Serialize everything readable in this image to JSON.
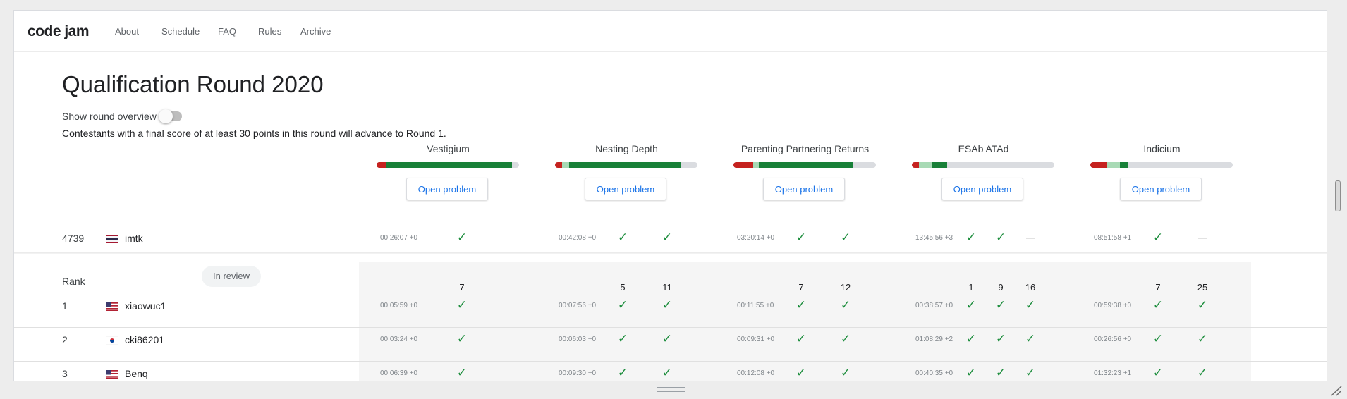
{
  "nav": {
    "brand": "code jam",
    "links": [
      "About",
      "Schedule",
      "FAQ",
      "Rules",
      "Archive"
    ]
  },
  "round": {
    "title": "Qualification Round 2020",
    "toggle_label": "Show round overview",
    "toggle_on": false,
    "notice": "Contestants with a final score of at least 30 points in this round will advance to Round 1."
  },
  "problems": [
    {
      "name": "Vestigium",
      "button": "Open problem"
    },
    {
      "name": "Nesting Depth",
      "button": "Open problem"
    },
    {
      "name": "Parenting Partnering Returns",
      "button": "Open problem"
    },
    {
      "name": "ESAb ATAd",
      "button": "Open problem"
    },
    {
      "name": "Indicium",
      "button": "Open problem"
    }
  ],
  "colors": {
    "solved_dark": "#188038",
    "solved_light": "#a8dab5",
    "wrong": "#c5221f",
    "unattempted": "#dadce0",
    "check": "#1e8e3e",
    "link": "#1a73e8"
  },
  "progress_fractions": [
    {
      "wrong": 0.07,
      "light": 0.0,
      "dark": 0.88
    },
    {
      "wrong": 0.05,
      "light": 0.05,
      "dark": 0.78
    },
    {
      "wrong": 0.14,
      "light": 0.04,
      "dark": 0.66
    },
    {
      "wrong": 0.05,
      "light": 0.09,
      "dark": 0.11
    },
    {
      "wrong": 0.12,
      "light": 0.09,
      "dark": 0.05
    }
  ],
  "my_row": {
    "rank": "4739",
    "country": "TH",
    "name": "imtk",
    "cells": [
      {
        "time": "00:26:07 +0",
        "marks": [
          "check"
        ]
      },
      {
        "time": "00:42:08 +0",
        "marks": [
          "check",
          "check"
        ]
      },
      {
        "time": "03:20:14 +0",
        "marks": [
          "check",
          "check"
        ]
      },
      {
        "time": "13:45:56 +3",
        "marks": [
          "check",
          "check",
          "dash"
        ]
      },
      {
        "time": "08:51:58 +1",
        "marks": [
          "check",
          "dash"
        ]
      }
    ]
  },
  "table": {
    "rank_header": "Rank",
    "status_badge": "In review",
    "points": [
      [
        "7"
      ],
      [
        "5",
        "11"
      ],
      [
        "7",
        "12"
      ],
      [
        "1",
        "9",
        "16"
      ],
      [
        "7",
        "25"
      ]
    ],
    "rows": [
      {
        "rank": "1",
        "country": "US",
        "name": "xiaowuc1",
        "cells": [
          {
            "time": "00:05:59 +0",
            "marks": [
              "check"
            ]
          },
          {
            "time": "00:07:56 +0",
            "marks": [
              "check",
              "check"
            ]
          },
          {
            "time": "00:11:55 +0",
            "marks": [
              "check",
              "check"
            ]
          },
          {
            "time": "00:38:57 +0",
            "marks": [
              "check",
              "check",
              "check"
            ]
          },
          {
            "time": "00:59:38 +0",
            "marks": [
              "check",
              "check"
            ]
          }
        ]
      },
      {
        "rank": "2",
        "country": "KR",
        "name": "cki86201",
        "cells": [
          {
            "time": "00:03:24 +0",
            "marks": [
              "check"
            ]
          },
          {
            "time": "00:06:03 +0",
            "marks": [
              "check",
              "check"
            ]
          },
          {
            "time": "00:09:31 +0",
            "marks": [
              "check",
              "check"
            ]
          },
          {
            "time": "01:08:29 +2",
            "marks": [
              "check",
              "check",
              "check"
            ]
          },
          {
            "time": "00:26:56 +0",
            "marks": [
              "check",
              "check"
            ]
          }
        ]
      },
      {
        "rank": "3",
        "country": "US",
        "name": "Benq",
        "cells": [
          {
            "time": "00:06:39 +0",
            "marks": [
              "check"
            ]
          },
          {
            "time": "00:09:30 +0",
            "marks": [
              "check",
              "check"
            ]
          },
          {
            "time": "00:12:08 +0",
            "marks": [
              "check",
              "check"
            ]
          },
          {
            "time": "00:40:35 +0",
            "marks": [
              "check",
              "check",
              "check"
            ]
          },
          {
            "time": "01:32:23 +1",
            "marks": [
              "check",
              "check"
            ]
          }
        ]
      }
    ]
  },
  "glyphs": {
    "check": "✓",
    "dash": "—"
  }
}
